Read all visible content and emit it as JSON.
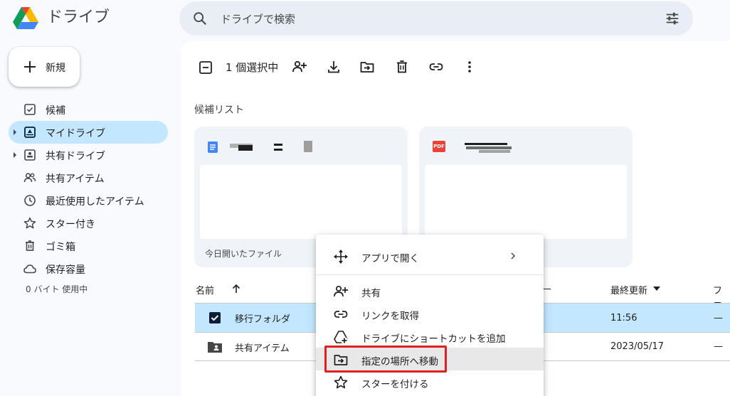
{
  "header": {
    "brand": "ドライブ",
    "search_placeholder": "ドライブで検索"
  },
  "new_button": {
    "label": "新規"
  },
  "sidebar": {
    "items": [
      {
        "label": "候補",
        "icon": "check-box-icon"
      },
      {
        "label": "マイドライブ",
        "icon": "my-drive-icon",
        "active": true,
        "expandable": true
      },
      {
        "label": "共有ドライブ",
        "icon": "shared-drive-icon",
        "expandable": true
      },
      {
        "label": "共有アイテム",
        "icon": "people-icon"
      },
      {
        "label": "最近使用したアイテム",
        "icon": "clock-icon"
      },
      {
        "label": "スター付き",
        "icon": "star-icon"
      },
      {
        "label": "ゴミ箱",
        "icon": "trash-icon"
      },
      {
        "label": "保存容量",
        "icon": "cloud-icon"
      }
    ],
    "storage_text": "0 バイト 使用中"
  },
  "toolbar": {
    "selection_count": "1 個選択中"
  },
  "suggestions": {
    "title": "候補リスト",
    "cards": [
      {
        "type": "doc",
        "icon": "google-docs-icon",
        "reason": "今日開いたファイル"
      },
      {
        "type": "pdf",
        "icon": "pdf-icon",
        "badge": "PDF"
      }
    ]
  },
  "file_list": {
    "columns": {
      "name": "名前",
      "modified": "最終更新",
      "size_partial": "ファ"
    },
    "rows": [
      {
        "name": "移行フォルダ",
        "modified": "11:56",
        "size": "—",
        "selected": true
      },
      {
        "name": "共有アイテム",
        "modified": "2023/05/17",
        "size": "—",
        "selected": false
      }
    ]
  },
  "context_menu": {
    "items": [
      {
        "label": "アプリで開く",
        "icon": "open-with-icon",
        "submenu": true
      },
      {
        "label": "共有",
        "icon": "add-person-icon"
      },
      {
        "label": "リンクを取得",
        "icon": "link-icon"
      },
      {
        "label": "ドライブにショートカットを追加",
        "icon": "add-shortcut-icon"
      },
      {
        "label": "指定の場所へ移動",
        "icon": "move-to-folder-icon",
        "hovered": true
      },
      {
        "label": "スターを付ける",
        "icon": "star-icon"
      }
    ]
  },
  "colors": {
    "accent": "#0b57d0",
    "selected_bg": "#c2e7ff",
    "highlight": "#e02020"
  }
}
